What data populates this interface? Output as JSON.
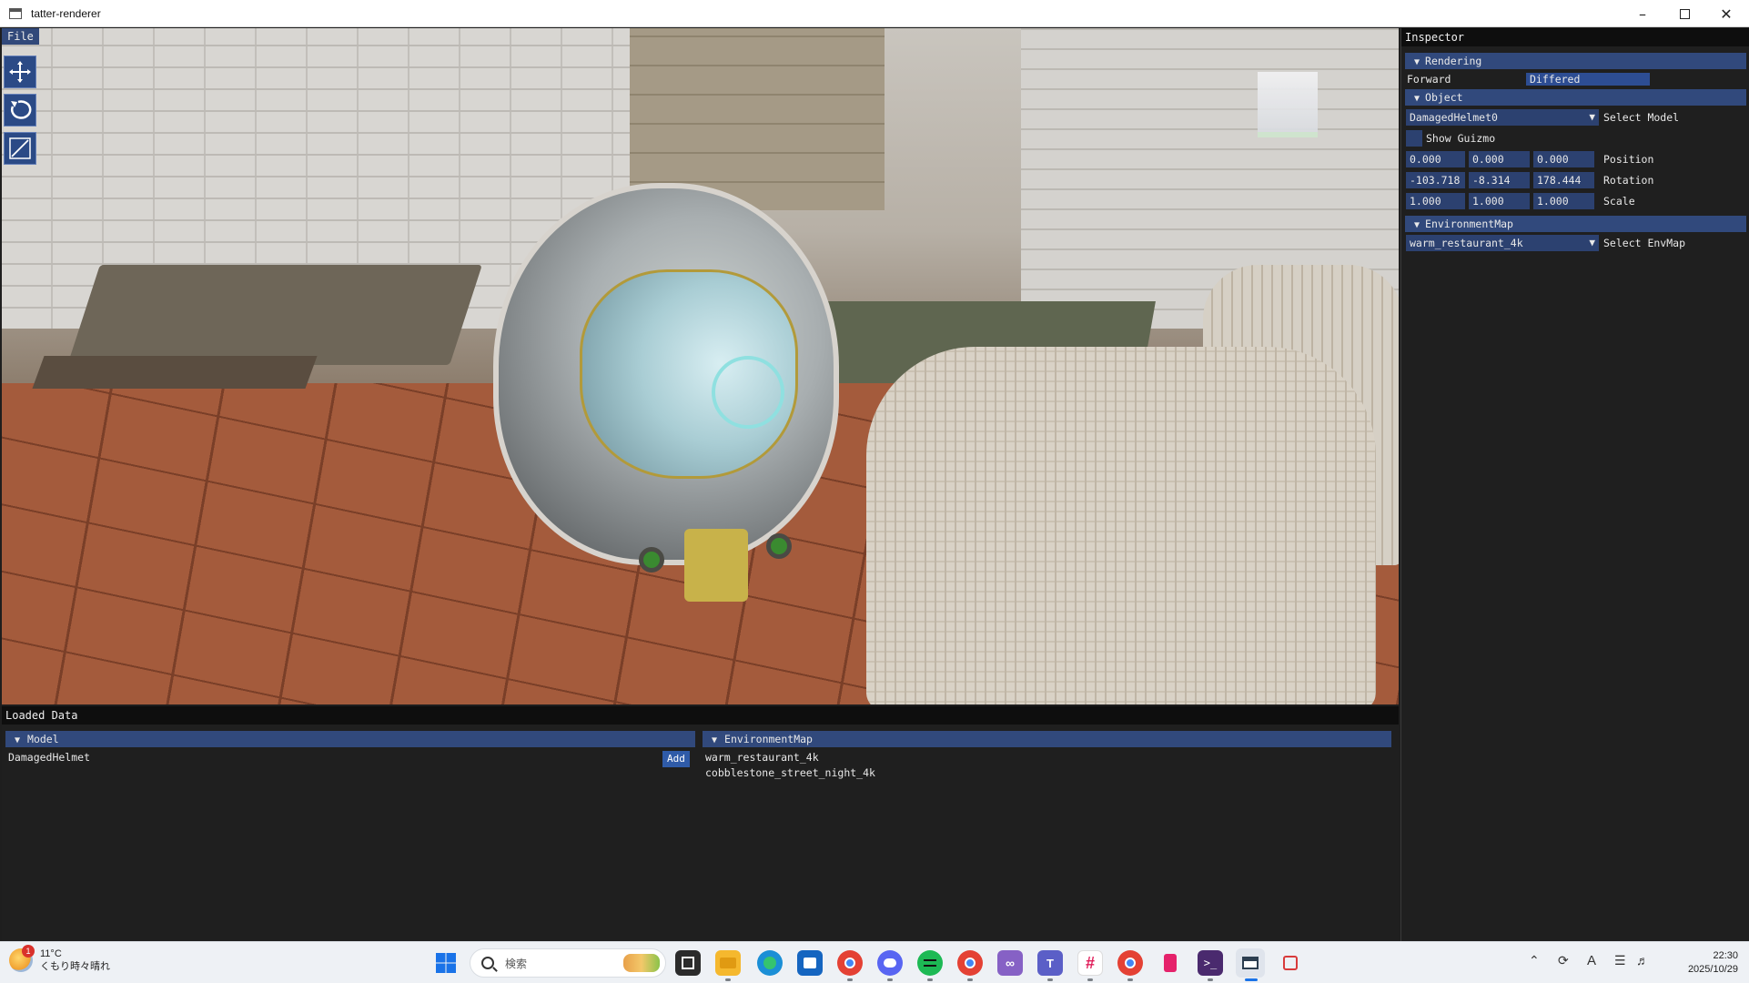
{
  "window": {
    "title": "tatter-renderer",
    "minimize_icon": "minimize-icon",
    "maximize_icon": "maximize-icon",
    "close_icon": "close-icon"
  },
  "viewport": {
    "menu": {
      "file_label": "File"
    },
    "tools": [
      {
        "name": "translate-tool",
        "icon": "move-arrows-icon"
      },
      {
        "name": "rotate-tool",
        "icon": "rotate-icon"
      },
      {
        "name": "scale-tool",
        "icon": "scale-icon"
      }
    ],
    "view_cube_icon": "view-cube-icon"
  },
  "inspector": {
    "title": "Inspector",
    "rendering": {
      "header": "Rendering",
      "option_forward": "Forward",
      "option_differed": "Differed",
      "selected": "Differed"
    },
    "object": {
      "header": "Object",
      "model_value": "DamagedHelmet0",
      "model_label": "Select Model",
      "show_guizmo_label": "Show Guizmo",
      "show_guizmo_checked": false,
      "position": [
        "0.000",
        "0.000",
        "0.000"
      ],
      "position_label": "Position",
      "rotation": [
        "-103.718",
        "-8.314",
        "178.444"
      ],
      "rotation_label": "Rotation",
      "scale": [
        "1.000",
        "1.000",
        "1.000"
      ],
      "scale_label": "Scale"
    },
    "environment_map": {
      "header": "EnvironmentMap",
      "value": "warm_restaurant_4k",
      "label": "Select EnvMap"
    }
  },
  "loaded_data": {
    "title": "Loaded Data",
    "model": {
      "header": "Model",
      "items": [
        "DamagedHelmet"
      ],
      "add_label": "Add"
    },
    "environment_map": {
      "header": "EnvironmentMap",
      "items": [
        "warm_restaurant_4k",
        "cobblestone_street_night_4k"
      ]
    }
  },
  "taskbar": {
    "weather": {
      "temp": "11°C",
      "desc": "くもり時々晴れ",
      "badge": "1"
    },
    "search_placeholder": "検索",
    "apps": [
      {
        "name": "start-button",
        "icon": "windows-logo-icon",
        "color": "#1a73e8"
      },
      {
        "name": "task-view-button",
        "icon": "task-view-icon",
        "color": "#2b2b2b"
      },
      {
        "name": "file-explorer-app",
        "icon": "folder-icon",
        "color": "#f5b82e"
      },
      {
        "name": "edge-app",
        "icon": "edge-icon",
        "color": "#1b8fd6"
      },
      {
        "name": "store-app",
        "icon": "store-icon",
        "color": "#1565c0"
      },
      {
        "name": "chrome-app",
        "icon": "chrome-icon",
        "color": "#e44134"
      },
      {
        "name": "discord-app",
        "icon": "discord-icon",
        "color": "#5865f2"
      },
      {
        "name": "spotify-app",
        "icon": "spotify-icon",
        "color": "#1db954"
      },
      {
        "name": "chrome-app-2",
        "icon": "chrome-icon",
        "color": "#e44134"
      },
      {
        "name": "visual-studio-app",
        "icon": "visual-studio-icon",
        "color": "#8661c5"
      },
      {
        "name": "teams-app",
        "icon": "teams-icon",
        "color": "#5b5fc7"
      },
      {
        "name": "slack-app",
        "icon": "slack-icon",
        "color": "#e01e5a"
      },
      {
        "name": "chrome-app-3",
        "icon": "chrome-icon",
        "color": "#e44134"
      },
      {
        "name": "bookmark-app",
        "icon": "bookmark-icon",
        "color": "#e5226b"
      },
      {
        "name": "terminal-app",
        "icon": "terminal-icon",
        "color": "#4a2a6e"
      },
      {
        "name": "tatter-renderer-app",
        "icon": "renderer-window-icon",
        "color": "#2c3e50"
      },
      {
        "name": "snipping-tool-app",
        "icon": "snipping-icon",
        "color": "#d83b3b"
      }
    ],
    "tray": {
      "chevron_icon": "chevron-up-icon",
      "sync_icon": "sync-icon",
      "ime_label": "A",
      "wifi_icon": "wifi-icon",
      "volume_icon": "volume-icon"
    },
    "time": "22:30",
    "date": "2025/10/29"
  }
}
